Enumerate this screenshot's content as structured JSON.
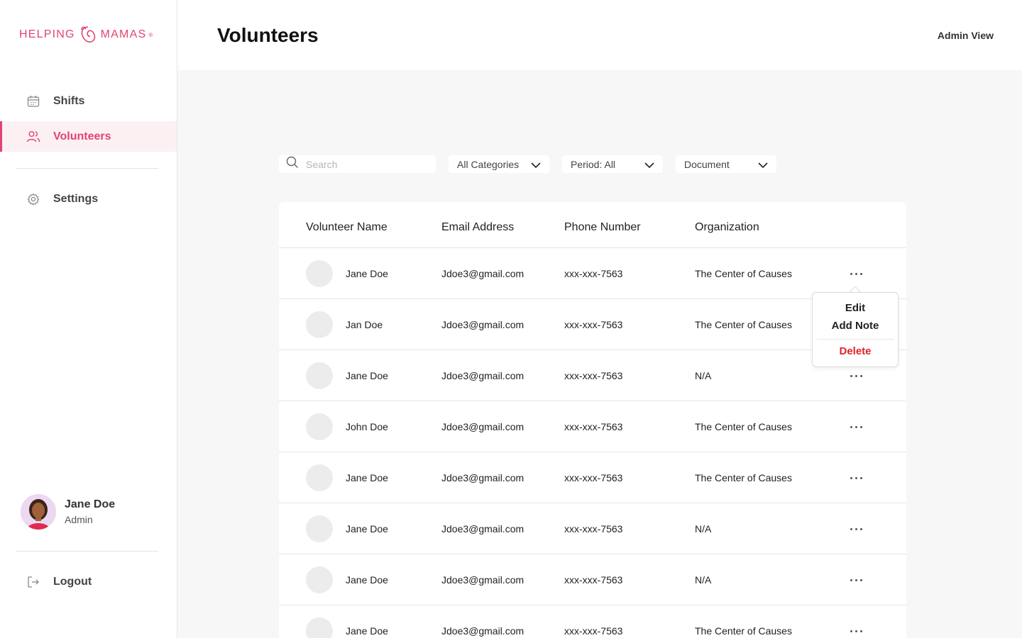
{
  "brand": {
    "name_left": "HELPING",
    "name_right": "MAMAS",
    "trademark": "®",
    "accent_color": "#e0456f"
  },
  "sidebar": {
    "items": [
      {
        "label": "Shifts",
        "icon": "calendar-icon"
      },
      {
        "label": "Volunteers",
        "icon": "users-icon",
        "active": true
      },
      {
        "label": "Settings",
        "icon": "gear-icon"
      }
    ],
    "user": {
      "name": "Jane Doe",
      "role": "Admin"
    },
    "logout_label": "Logout"
  },
  "header": {
    "title": "Volunteers",
    "view_label": "Admin View"
  },
  "filters": {
    "search_placeholder": "Search",
    "category": "All Categories",
    "period": "Period: All",
    "document": "Document"
  },
  "table": {
    "columns": [
      "Volunteer Name",
      "Email Address",
      "Phone Number",
      "Organization"
    ],
    "rows": [
      {
        "name": "Jane Doe",
        "email": "Jdoe3@gmail.com",
        "phone": "xxx-xxx-7563",
        "org": "The Center of Causes"
      },
      {
        "name": "Jan Doe",
        "email": "Jdoe3@gmail.com",
        "phone": "xxx-xxx-7563",
        "org": "The Center of Causes"
      },
      {
        "name": "Jane Doe",
        "email": "Jdoe3@gmail.com",
        "phone": "xxx-xxx-7563",
        "org": "N/A"
      },
      {
        "name": "John Doe",
        "email": "Jdoe3@gmail.com",
        "phone": "xxx-xxx-7563",
        "org": "The Center of Causes"
      },
      {
        "name": "Jane Doe",
        "email": "Jdoe3@gmail.com",
        "phone": "xxx-xxx-7563",
        "org": "The Center of Causes"
      },
      {
        "name": "Jane Doe",
        "email": "Jdoe3@gmail.com",
        "phone": "xxx-xxx-7563",
        "org": "N/A"
      },
      {
        "name": "Jane Doe",
        "email": "Jdoe3@gmail.com",
        "phone": "xxx-xxx-7563",
        "org": "N/A"
      },
      {
        "name": "Jane Doe",
        "email": "Jdoe3@gmail.com",
        "phone": "xxx-xxx-7563",
        "org": "The Center of Causes"
      }
    ]
  },
  "context_menu": {
    "edit": "Edit",
    "add_note": "Add Note",
    "delete": "Delete"
  }
}
